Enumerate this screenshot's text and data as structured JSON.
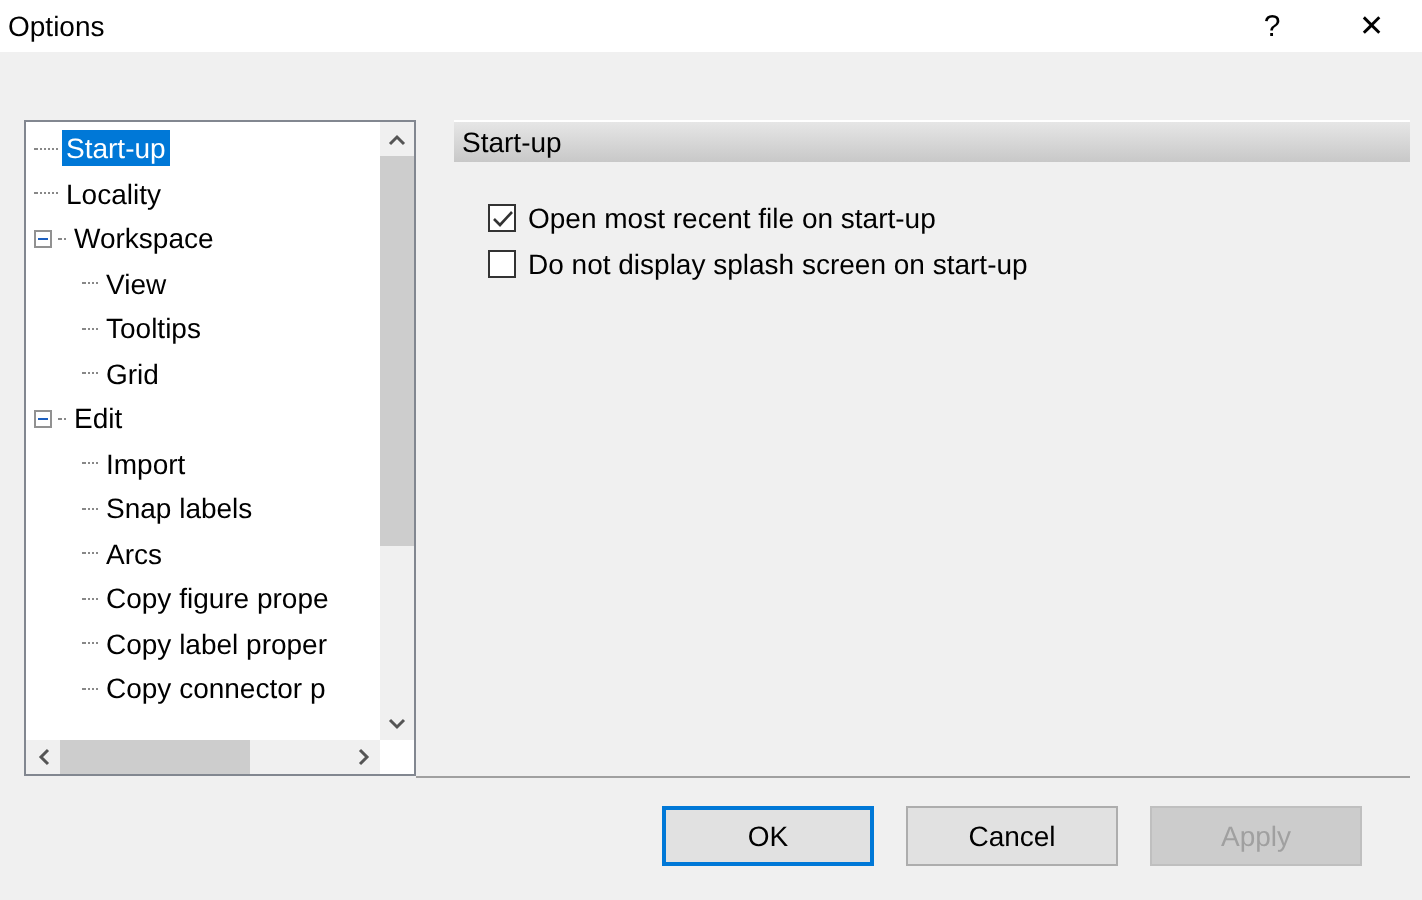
{
  "window": {
    "title": "Options",
    "help": "?",
    "close": "✕"
  },
  "tree": {
    "items": [
      {
        "label": "Start-up",
        "selected": true
      },
      {
        "label": "Locality",
        "selected": false
      },
      {
        "label": "Workspace",
        "selected": false,
        "expanded": true,
        "children": [
          {
            "label": "View",
            "selected": false
          },
          {
            "label": "Tooltips",
            "selected": false
          },
          {
            "label": "Grid",
            "selected": false
          }
        ]
      },
      {
        "label": "Edit",
        "selected": false,
        "expanded": true,
        "children": [
          {
            "label": "Import",
            "selected": false
          },
          {
            "label": "Snap labels",
            "selected": false
          },
          {
            "label": "Arcs",
            "selected": false
          },
          {
            "label": "Copy figure prope",
            "selected": false
          },
          {
            "label": "Copy label proper",
            "selected": false
          },
          {
            "label": "Copy connector p",
            "selected": false
          }
        ]
      }
    ]
  },
  "panel": {
    "title": "Start-up",
    "options": [
      {
        "label": "Open most recent file on start-up",
        "checked": true
      },
      {
        "label": "Do not display splash screen on start-up",
        "checked": false
      }
    ]
  },
  "buttons": [
    {
      "label": "OK",
      "default": true,
      "disabled": false
    },
    {
      "label": "Cancel",
      "default": false,
      "disabled": false
    },
    {
      "label": "Apply",
      "default": false,
      "disabled": true
    }
  ]
}
